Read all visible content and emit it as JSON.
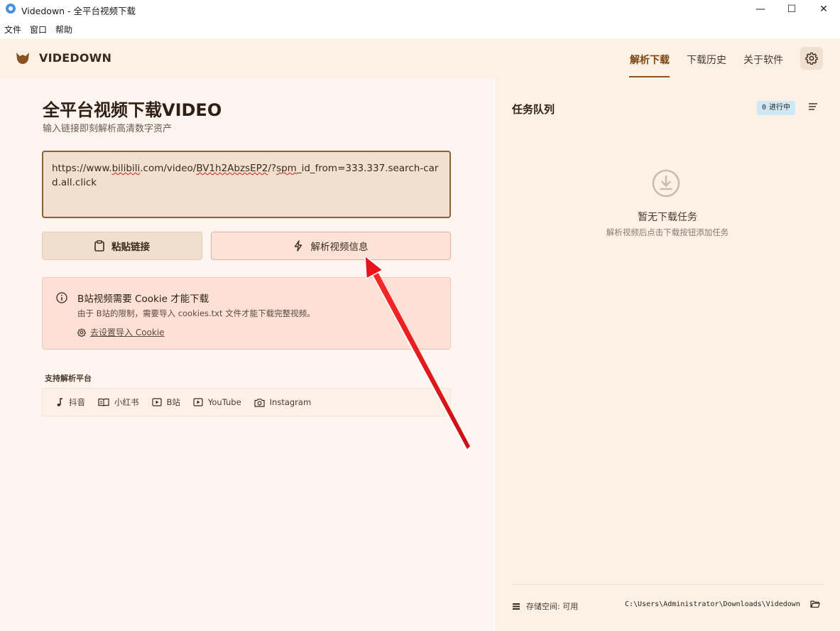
{
  "window": {
    "title": "Videdown - 全平台视频下载",
    "minimize_glyph": "—",
    "maximize_glyph": "☐",
    "close_glyph": "✕"
  },
  "menu": [
    "文件",
    "窗口",
    "帮助"
  ],
  "header": {
    "brand": "VIDEDOWN",
    "logo_icon": "fox-logo-icon",
    "tabs": [
      {
        "label": "解析下载",
        "active": true
      },
      {
        "label": "下载历史",
        "active": false
      },
      {
        "label": "关于软件",
        "active": false
      }
    ],
    "settings_icon": "gear-icon"
  },
  "main": {
    "title": "全平台视频下载VIDEO",
    "subtitle": "输入链接即刻解析高清数字资产",
    "url_value": {
      "p1": "https://www.",
      "p2": "bilibili",
      "p3": ".com/video/",
      "p4": "BV1h2AbzsEP2",
      "p5": "/?",
      "p6": "spm",
      "p7": "_id_from=333.337.search-card.all.click"
    },
    "paste_button": "粘贴链接",
    "parse_button": "解析视频信息",
    "notice": {
      "title": "B站视频需要 Cookie 才能下载",
      "text": "由于 B站的限制，需要导入 cookies.txt 文件才能下载完整视频。",
      "link": "去设置导入 Cookie"
    },
    "platforms_label": "支持解析平台",
    "platforms": [
      {
        "name": "抖音",
        "icon": "music-note-icon"
      },
      {
        "name": "小红书",
        "icon": "book-icon"
      },
      {
        "name": "B站",
        "icon": "play-icon"
      },
      {
        "name": "YouTube",
        "icon": "play-icon"
      },
      {
        "name": "Instagram",
        "icon": "camera-icon"
      }
    ]
  },
  "queue": {
    "title": "任务队列",
    "badge_count": "0",
    "badge_label": "进行中",
    "empty_title": "暂无下载任务",
    "empty_subtitle": "解析视频后点击下载按钮添加任务",
    "storage_label": "存储空间: 可用",
    "path": "C:\\Users\\Administrator\\Downloads\\Videdown"
  },
  "colors": {
    "accent": "#8b5220",
    "header_bg": "#fdf0e4",
    "left_bg": "#fff5f0",
    "badge_bg": "#cfe8f5",
    "annotation_arrow": "#e8141c"
  }
}
